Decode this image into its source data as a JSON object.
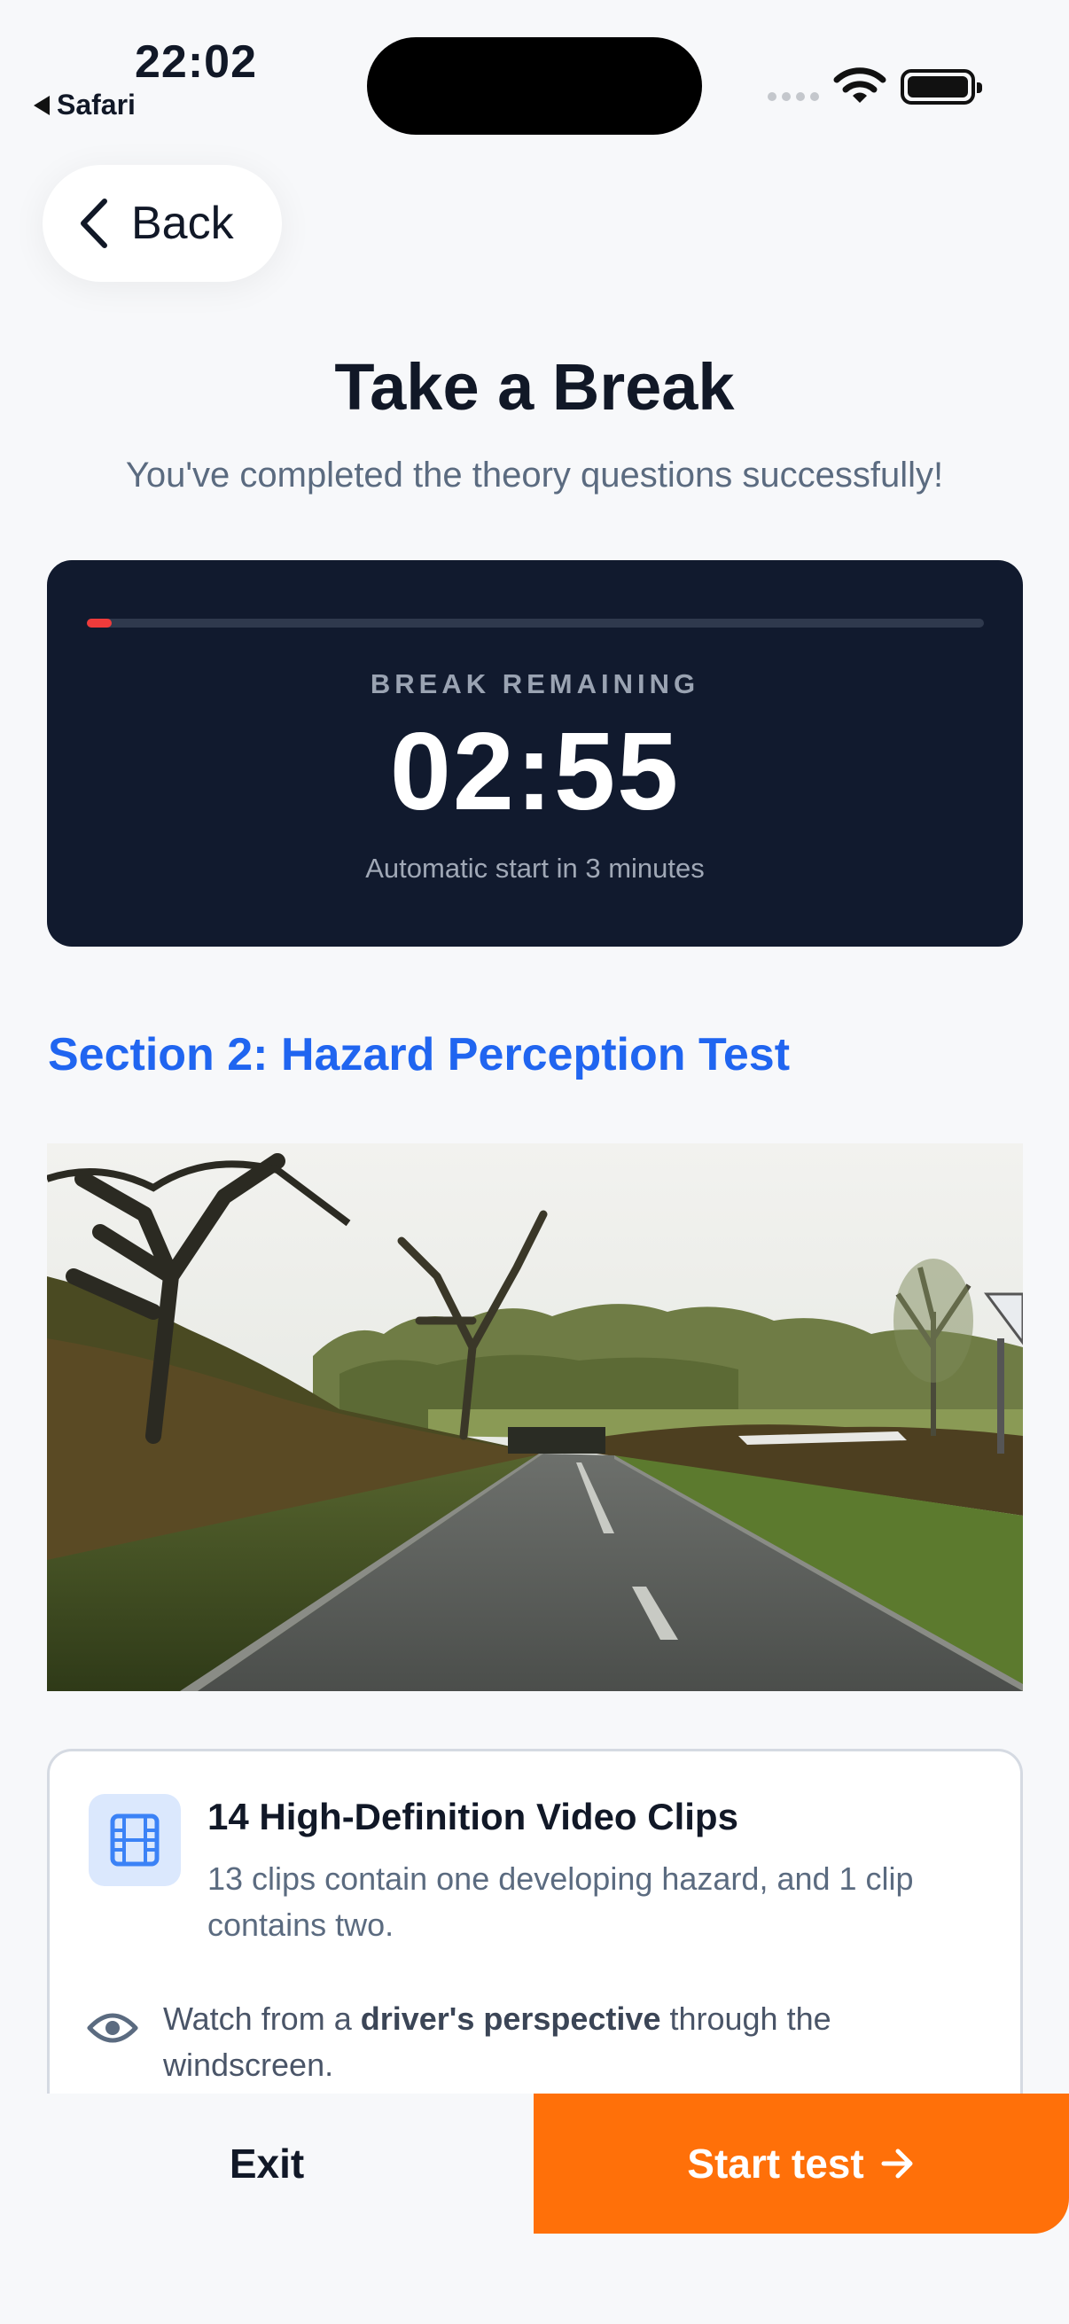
{
  "status_bar": {
    "time": "22:02",
    "back_app": "Safari"
  },
  "nav": {
    "back_label": "Back"
  },
  "header": {
    "title": "Take a Break",
    "subtitle": "You've completed the theory questions successfully!"
  },
  "timer": {
    "label": "BREAK REMAINING",
    "value": "02:55",
    "note": "Automatic start in 3 minutes",
    "elapsed_fraction": 0.028,
    "accent": "#ef3b3b"
  },
  "section": {
    "heading": "Section 2: Hazard Perception Test"
  },
  "info": {
    "feature_icon": "film-icon",
    "feature_title": "14 High-Definition Video Clips",
    "feature_desc": "13 clips contain one developing hazard, and 1 clip contains two.",
    "watch_icon": "eye-icon",
    "watch_prefix": "Watch from a ",
    "watch_bold": "driver's perspective",
    "watch_suffix": " through the windscreen."
  },
  "actions": {
    "exit_label": "Exit",
    "start_label": "Start test",
    "start_color": "#ff7009"
  }
}
